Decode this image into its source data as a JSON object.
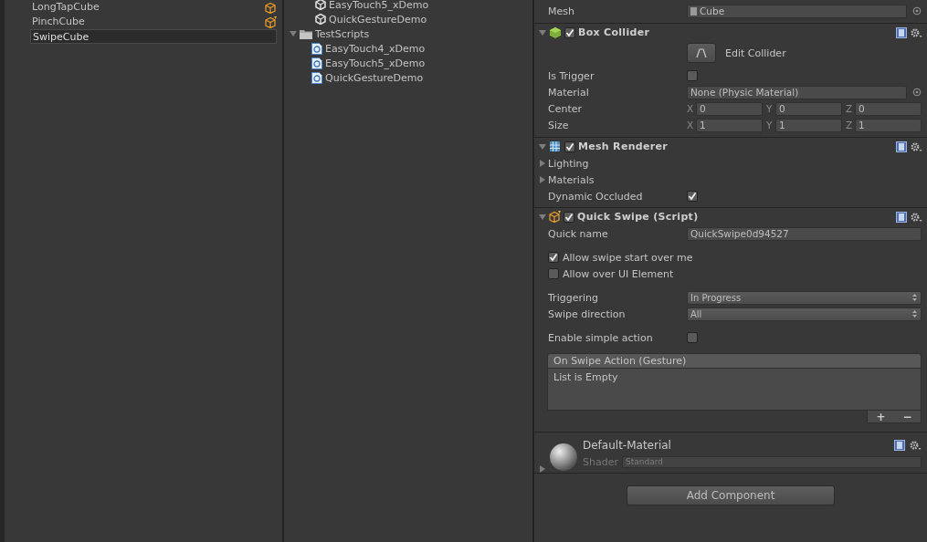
{
  "hierarchy": {
    "items": [
      {
        "label": "LongTapCube",
        "kind": "prefab",
        "editing": false
      },
      {
        "label": "PinchCube",
        "kind": "script_prefab",
        "editing": false
      },
      {
        "label": "SwipeCube",
        "kind": "plain",
        "editing": true
      }
    ]
  },
  "project": {
    "items": [
      {
        "label": "EasyTouch5_xDemo",
        "kind": "scene"
      },
      {
        "label": "QuickGestureDemo",
        "kind": "scene"
      },
      {
        "label": "TestScripts",
        "kind": "folder",
        "expanded": true,
        "children": [
          {
            "label": "EasyTouch4_xDemo",
            "kind": "script"
          },
          {
            "label": "EasyTouch5_xDemo",
            "kind": "script"
          },
          {
            "label": "QuickGestureDemo",
            "kind": "script"
          }
        ]
      }
    ]
  },
  "inspector": {
    "mesh": {
      "label": "Mesh",
      "value": "Cube"
    },
    "components": [
      {
        "kind": "box_collider",
        "title": "Box Collider",
        "enabled": true,
        "expanded": true,
        "edit_button": "Edit Collider",
        "rows": [
          {
            "kind": "checkbox",
            "label": "Is Trigger",
            "checked": false
          },
          {
            "kind": "object",
            "label": "Material",
            "value": "None (Physic Material)"
          },
          {
            "kind": "vector",
            "label": "Center",
            "fields": [
              {
                "axis": "X",
                "value": "0"
              },
              {
                "axis": "Y",
                "value": "0"
              },
              {
                "axis": "Z",
                "value": "0"
              }
            ]
          },
          {
            "kind": "vector",
            "label": "Size",
            "fields": [
              {
                "axis": "X",
                "value": "1"
              },
              {
                "axis": "Y",
                "value": "1"
              },
              {
                "axis": "Z",
                "value": "1"
              }
            ]
          }
        ]
      },
      {
        "kind": "mesh_renderer",
        "title": "Mesh Renderer",
        "enabled": true,
        "expanded": true,
        "rows": [
          {
            "kind": "foldout",
            "label": "Lighting",
            "expanded": false
          },
          {
            "kind": "foldout",
            "label": "Materials",
            "expanded": false
          },
          {
            "kind": "checkbox",
            "label": "Dynamic Occluded",
            "checked": true
          }
        ]
      },
      {
        "kind": "script",
        "title": "Quick Swipe (Script)",
        "enabled": true,
        "expanded": true,
        "rows": [
          {
            "kind": "text",
            "label": "Quick name",
            "value": "QuickSwipe0d94527"
          },
          {
            "kind": "toggle",
            "label": "Allow swipe start over me",
            "checked": true
          },
          {
            "kind": "toggle",
            "label": "Allow over UI Element",
            "checked": false
          },
          {
            "kind": "dropdown",
            "label": "Triggering",
            "value": "In Progress"
          },
          {
            "kind": "dropdown",
            "label": "Swipe direction",
            "value": "All"
          },
          {
            "kind": "checkbox",
            "label": "Enable simple action",
            "checked": false
          },
          {
            "kind": "event",
            "header": "On Swipe Action (Gesture)",
            "empty": "List is Empty",
            "add": "+",
            "remove": "−"
          }
        ]
      }
    ],
    "material": {
      "name": "Default-Material",
      "shader_label": "Shader",
      "shader": "Standard",
      "expanded": false
    },
    "add_component": "Add Component"
  }
}
